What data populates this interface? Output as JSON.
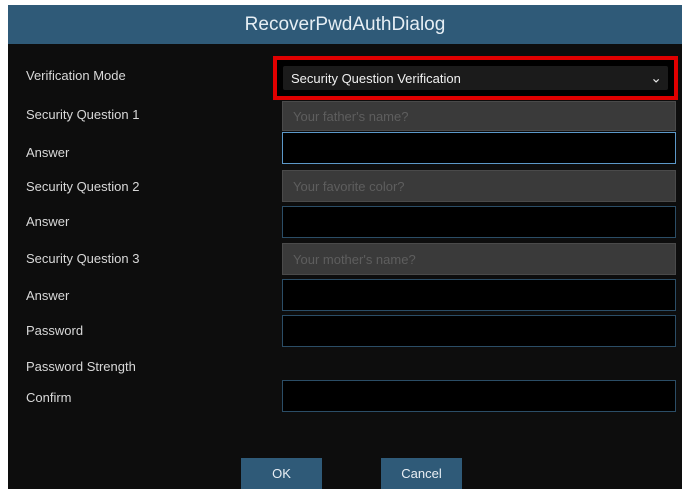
{
  "dialog": {
    "title": "RecoverPwdAuthDialog",
    "verification_mode_label": "Verification Mode",
    "verification_mode_value": "Security Question Verification",
    "security_question_1_label": "Security Question 1",
    "security_question_1_value": "Your father's name?",
    "answer_1_label": "Answer",
    "security_question_2_label": "Security Question 2",
    "security_question_2_value": "Your favorite color?",
    "answer_2_label": "Answer",
    "security_question_3_label": "Security Question 3",
    "security_question_3_value": "Your mother's name?",
    "answer_3_label": "Answer",
    "password_label": "Password",
    "password_strength_label": "Password Strength",
    "confirm_label": "Confirm",
    "ok_label": "OK",
    "cancel_label": "Cancel"
  },
  "colors": {
    "title_bar": "#2f5a78",
    "highlight": "#e00000",
    "background": "#0d0d0d"
  }
}
